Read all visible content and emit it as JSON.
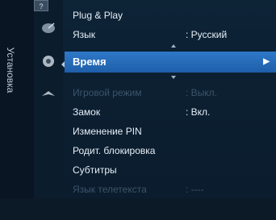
{
  "sidebar": {
    "label": "Установка"
  },
  "menu": {
    "items": [
      {
        "label": "Plug & Play",
        "value": ""
      },
      {
        "label": "Язык",
        "value": ": Русский"
      },
      {
        "label": "Время",
        "value": ""
      },
      {
        "label": "Игровой режим",
        "value": ": Выкл."
      },
      {
        "label": "Замок",
        "value": ": Вкл."
      },
      {
        "label": "Изменение PIN",
        "value": ""
      },
      {
        "label": "Родит. блокировка",
        "value": ""
      },
      {
        "label": "Субтитры",
        "value": ""
      },
      {
        "label": "Язык телетекста",
        "value": ": ----"
      }
    ],
    "selected_arrow": "▶"
  },
  "icons": {
    "channel": "satellite-dish-icon",
    "setup": "gear-icon",
    "input": "input-icon",
    "help": "?"
  },
  "colors": {
    "highlight": "#2f79c8",
    "background": "#0a1b2c",
    "text": "#e6eef6",
    "disabled": "#3d5469"
  }
}
